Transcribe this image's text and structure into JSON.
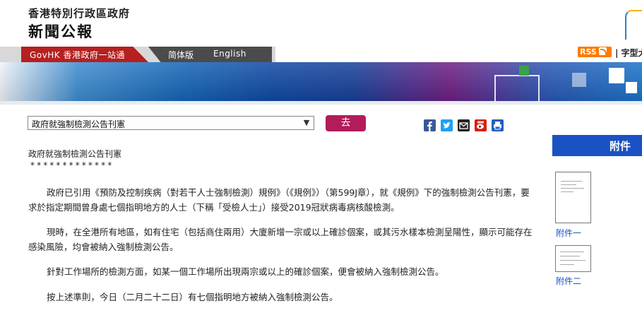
{
  "header": {
    "site_name": "香港特別行政區政府",
    "site_sub": "新聞公報"
  },
  "nav": {
    "govhk": "GovHK 香港政府一站通",
    "simplified": "简体版",
    "english": "English",
    "rss": "RSS",
    "font_size": "| 字型大"
  },
  "toolbar": {
    "select_value": "政府就強制檢測公告刊憲",
    "go_label": "去"
  },
  "share_icons": [
    "facebook-icon",
    "twitter-icon",
    "email-icon",
    "weibo-icon",
    "print-icon"
  ],
  "article": {
    "title": "政府就強制檢測公告刊憲",
    "stars": "*************",
    "p1": "政府已引用《預防及控制疾病（對若干人士強制檢測）規例》（《規例》）（第599J章），就《規例》下的強制檢測公告刊憲，要求於指定期間曾身處七個指明地方的人士（下稱「受檢人士」）接受2019冠狀病毒病核酸檢測。",
    "p2": "現時，在全港所有地區，如有住宅（包括商住兩用）大廈新增一宗或以上確診個案，或其污水樣本檢測呈陽性，顯示可能存在感染風險，均會被納入強制檢測公告。",
    "p3": "針對工作場所的檢測方面，如某一個工作場所出現兩宗或以上的確診個案，便會被納入強制檢測公告。",
    "p4": "按上述準則，今日（二月二十二日）有七個指明地方被納入強制檢測公告。"
  },
  "attachments": {
    "heading": "附件",
    "items": [
      {
        "label": "附件一"
      },
      {
        "label": "附件二"
      }
    ]
  },
  "colors": {
    "brand_red": "#b52020",
    "go_button": "#b21c5a",
    "attachment_blue": "#1a52c4",
    "rss_orange": "#ff7a00"
  }
}
